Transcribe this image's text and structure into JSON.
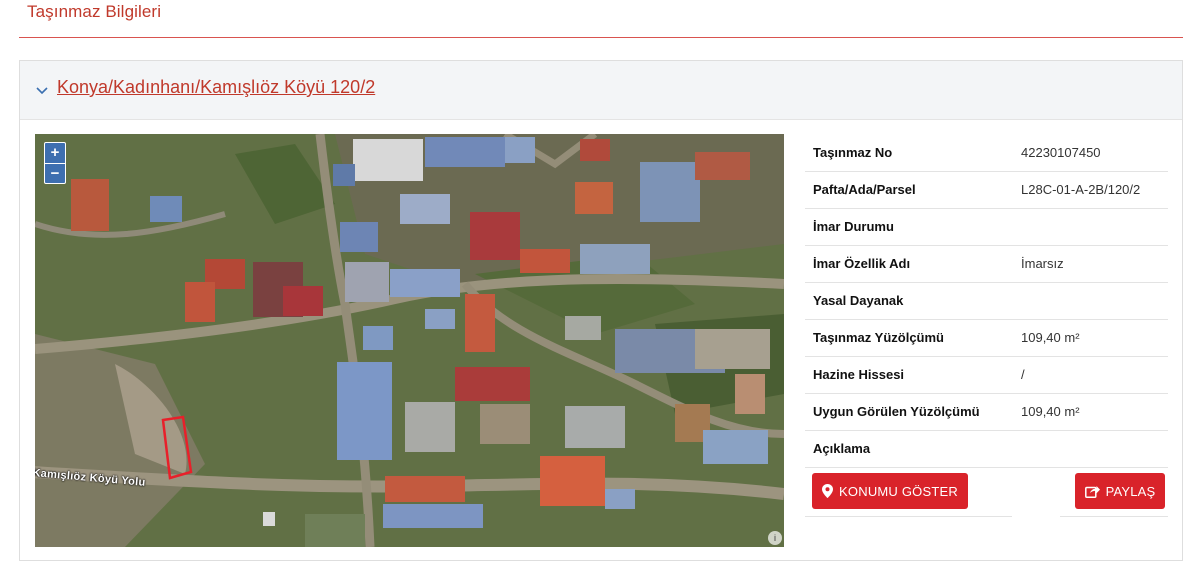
{
  "page": {
    "title": "Taşınmaz Bilgileri"
  },
  "parcel": {
    "link": "Konya/Kadınhanı/Kamışlıöz Köyü 120/2"
  },
  "map": {
    "zoom_in": "+",
    "zoom_out": "−",
    "road_label": "Kamışlıöz Köyü Yolu",
    "info_glyph": "i",
    "parcel_outline_color": "#e8202a"
  },
  "details": [
    {
      "label": "Taşınmaz No",
      "value": "42230107450"
    },
    {
      "label": "Pafta/Ada/Parsel",
      "value": "L28C-01-A-2B/120/2"
    },
    {
      "label": "İmar Durumu",
      "value": ""
    },
    {
      "label": "İmar Özellik Adı",
      "value": "İmarsız"
    },
    {
      "label": "Yasal Dayanak",
      "value": ""
    },
    {
      "label": "Taşınmaz Yüzölçümü",
      "value": "109,40 m²"
    },
    {
      "label": "Hazine Hissesi",
      "value": "/"
    },
    {
      "label": "Uygun Görülen Yüzölçümü",
      "value": "109,40 m²"
    },
    {
      "label": "Açıklama",
      "value": ""
    }
  ],
  "buttons": {
    "show_location": "KONUMU GÖSTER",
    "share": "PAYLAŞ",
    "show_location_icon": "map-marker-icon",
    "share_icon": "share-icon"
  },
  "colors": {
    "accent": "#c0392b",
    "button": "#d9232a",
    "zoom": "#3e6fb0"
  }
}
